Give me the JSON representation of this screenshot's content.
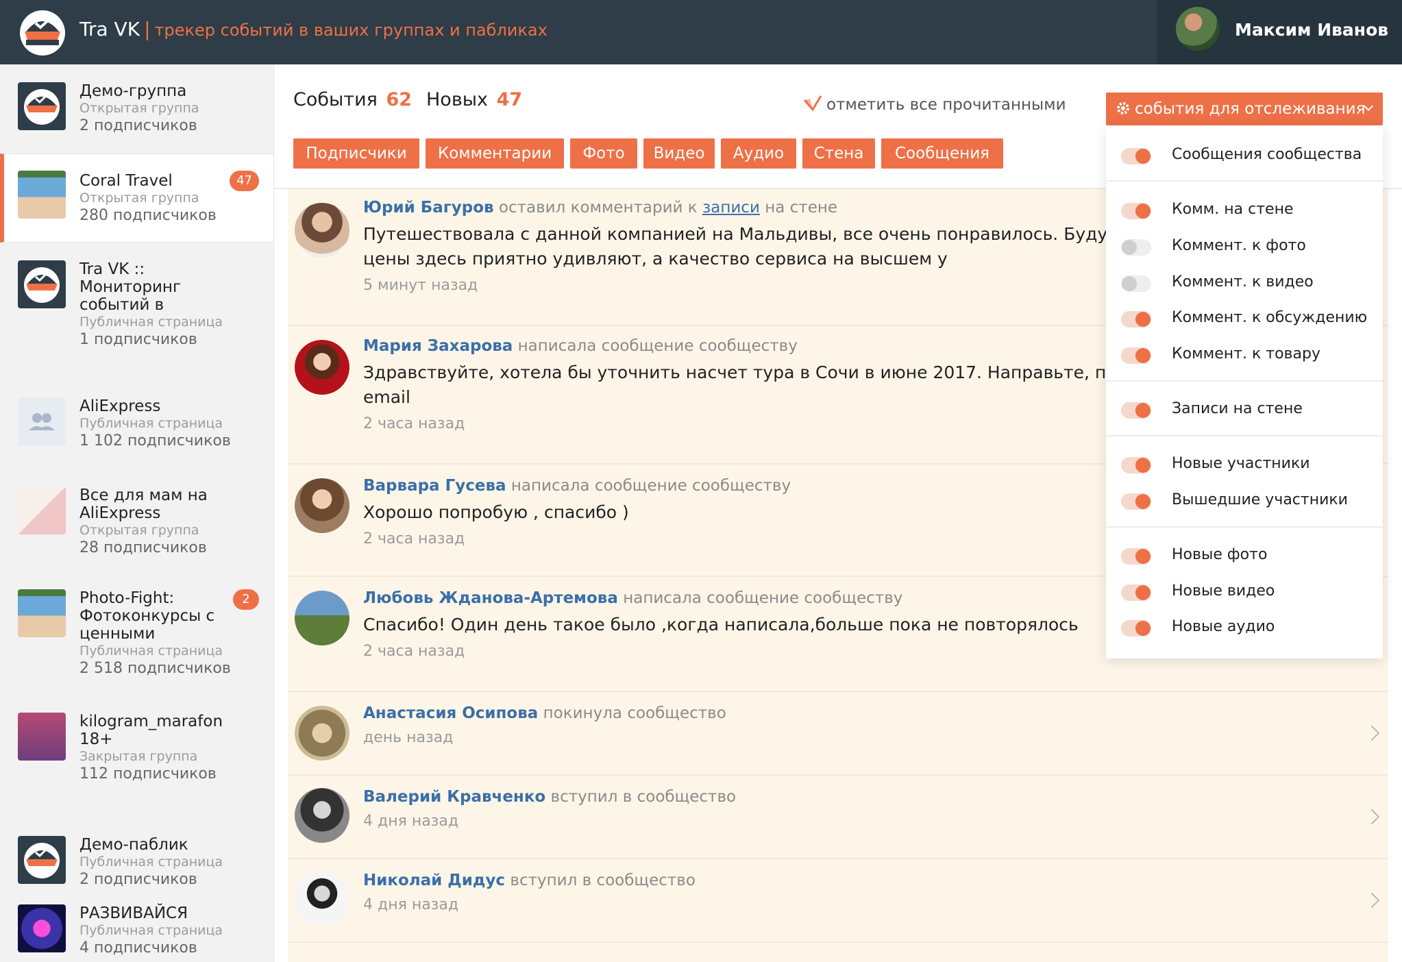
{
  "header": {
    "app_name": "Tra VK",
    "separator": "|",
    "tagline": "трекер событий в ваших группах и пабликах",
    "user_name": "Максим Иванов"
  },
  "colors": {
    "accent": "#ee7047",
    "header_bg": "#2e3d47",
    "link": "#3b6fa8",
    "event_bg": "#fdf6e8"
  },
  "sidebar": {
    "groups": [
      {
        "name": "Демо-группа",
        "type": "Открытая группа",
        "subscribers": "2 подписчиков",
        "badge": "",
        "icon": "cap-logo"
      },
      {
        "name": "Coral Travel",
        "type": "Открытая группа",
        "subscribers": "280 подписчиков",
        "badge": "47",
        "icon": "photo-fight-thumbnail"
      },
      {
        "name": "Tra VK :: Мониторинг событий в",
        "type": "Публичная страница",
        "subscribers": "1 подписчиков",
        "badge": "",
        "icon": "cap-logo"
      },
      {
        "name": "AliExpress",
        "type": "Публичная страница",
        "subscribers": "1 102 подписчиков",
        "badge": "",
        "icon": "people-icon"
      },
      {
        "name": "Все для мам на AliExpress",
        "type": "Открытая группа",
        "subscribers": "28 подписчиков",
        "badge": "",
        "icon": "baby-photo"
      },
      {
        "name": "Photo-Fight: Фотоконкурсы с ценными",
        "type": "Публичная страница",
        "subscribers": "2 518 подписчиков",
        "badge": "2",
        "icon": "photo-fight-thumbnail"
      },
      {
        "name": "kilogram_marafon 18+",
        "type": "Закрытая группа",
        "subscribers": "112 подписчиков",
        "badge": "",
        "icon": "kilogram-photo"
      },
      {
        "name": "Демо-паблик",
        "type": "Публичная страница",
        "subscribers": "2 подписчиков",
        "badge": "",
        "icon": "cap-logo"
      },
      {
        "name": "РАЗВИВАЙСЯ",
        "type": "Публичная страница",
        "subscribers": "4 подписчиков",
        "badge": "",
        "icon": "brain-photo"
      }
    ]
  },
  "main": {
    "events_label": "События",
    "events_count": "62",
    "new_label": "Новых",
    "new_count": "47",
    "mark_all_read": "отметить все прочитанными",
    "filters": [
      "Подписчики",
      "Комментарии",
      "Фото",
      "Видео",
      "Аудио",
      "Стена",
      "Сообщения"
    ],
    "tracking_button": "события для отслеживания"
  },
  "feed": [
    {
      "author": "Юрий Багуров",
      "action": "оставил комментарий к",
      "link": "записи",
      "suffix": "на стене",
      "text": "Путешествовала с данной компанией на Мальдивы, все очень понравилось. Буду пр туры через вас. Ведь цены здесь приятно удивляют, а качество сервиса на высшем у",
      "time": "5 минут назад"
    },
    {
      "author": "Мария Захарова",
      "action": "написала сообщение сообществу",
      "link": "",
      "suffix": "",
      "text": "Здравствуйте, хотела бы уточнить насчет тура в Сочи в июне 2017. Направьте, пожал информацию на мой email",
      "time": "2 часа назад"
    },
    {
      "author": "Варвара Гусева",
      "action": "написала сообщение сообществу",
      "link": "",
      "suffix": "",
      "text": "Хорошо попробую , спасибо )",
      "time": "2 часа назад"
    },
    {
      "author": "Любовь Жданова-Артемова",
      "action": "написала сообщение сообществу",
      "link": "",
      "suffix": "",
      "text": "Спасибо! Один день такое было ,когда написала,больше пока не повторялось",
      "time": "2 часа назад"
    },
    {
      "author": "Анастасия Осипова",
      "action": "покинула сообщество",
      "link": "",
      "suffix": "",
      "text": "",
      "time": "день назад"
    },
    {
      "author": "Валерий Кравченко",
      "action": "вступил в сообщество",
      "link": "",
      "suffix": "",
      "text": "",
      "time": "4 дня назад"
    },
    {
      "author": "Николай Дидус",
      "action": "вступил в сообщество",
      "link": "",
      "suffix": "",
      "text": "",
      "time": "4 дня назад"
    }
  ],
  "tracking": [
    {
      "label": "Сообщения сообщества",
      "on": true
    },
    {
      "label": "Комм. на стене",
      "on": true
    },
    {
      "label": "Коммент. к фото",
      "on": false
    },
    {
      "label": "Коммент. к видео",
      "on": false
    },
    {
      "label": "Коммент. к обсуждению",
      "on": true
    },
    {
      "label": "Коммент. к товару",
      "on": true
    },
    {
      "label": "Записи на стене",
      "on": true
    },
    {
      "label": "Новые участники",
      "on": true
    },
    {
      "label": "Вышедшие участники",
      "on": true
    },
    {
      "label": "Новые фото",
      "on": true
    },
    {
      "label": "Новые видео",
      "on": true
    },
    {
      "label": "Новые аудио",
      "on": true
    }
  ]
}
